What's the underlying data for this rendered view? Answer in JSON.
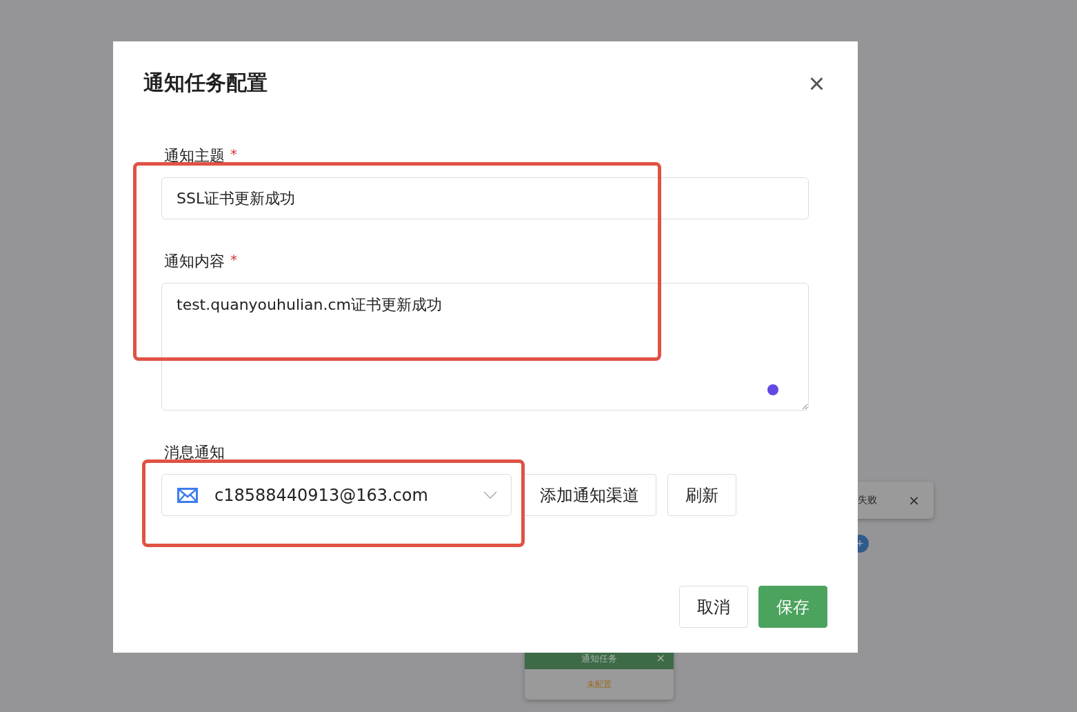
{
  "background": {
    "nodes": [
      {
        "kind": "result",
        "label": "失败",
        "close": "×"
      },
      {
        "kind": "task",
        "title": "通知任务",
        "close": "×",
        "status": "未配置"
      }
    ],
    "add_button": "+"
  },
  "dialog": {
    "title": "通知任务配置",
    "close": "×",
    "fields": [
      {
        "kind": "input",
        "label": "通知主题",
        "required_mark": "*",
        "value": "SSL证书更新成功"
      },
      {
        "kind": "textarea",
        "label": "通知内容",
        "required_mark": "*",
        "value": "test.quanyouhulian.cm证书更新成功"
      },
      {
        "kind": "select",
        "label": "消息通知",
        "value": "c18588440913@163.com",
        "buttons": [
          "添加通知渠道",
          "刷新"
        ]
      }
    ],
    "footer": [
      {
        "label": "取消",
        "primary": false
      },
      {
        "label": "保存",
        "primary": true
      }
    ]
  },
  "annotations": [
    {
      "kind": "rectangle"
    },
    {
      "kind": "rectangle"
    }
  ]
}
